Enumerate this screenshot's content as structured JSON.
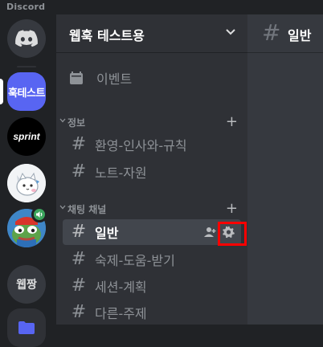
{
  "app": {
    "title": "Discord"
  },
  "servers": [
    {
      "name": "discord-home",
      "kind": "home"
    },
    {
      "label": "훅테스트",
      "selected": true
    },
    {
      "label": "sprint"
    },
    {
      "name": "cat-server"
    },
    {
      "name": "frog-server",
      "voice_active": true
    },
    {
      "label": "웹짱"
    },
    {
      "name": "folder"
    }
  ],
  "guild": {
    "name": "웹훅 테스트용"
  },
  "events": {
    "label": "이벤트"
  },
  "categories": [
    {
      "label": "정보",
      "channels": [
        {
          "label": "환영-인사와-규칙"
        },
        {
          "label": "노트-자원"
        }
      ]
    },
    {
      "label": "채팅 채널",
      "channels": [
        {
          "label": "일반",
          "active": true
        },
        {
          "label": "숙제-도움-받기"
        },
        {
          "label": "세션-계획"
        },
        {
          "label": "다른-주제"
        }
      ]
    }
  ],
  "main": {
    "channel_title": "일반"
  },
  "colors": {
    "accent": "#5865f2",
    "highlight_box": "#ff0000",
    "voice_green": "#3ba55d"
  }
}
